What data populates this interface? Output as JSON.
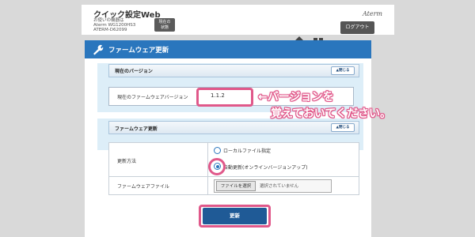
{
  "header": {
    "app_title": "クイック設定Web",
    "device_lines": [
      "お使いの機器は",
      "Aterm WG1200HS3",
      "ATERM-D62099"
    ],
    "status_button_lines": [
      "現在の",
      "状態"
    ],
    "brand": "Aterm",
    "logout_label": "ログアウト"
  },
  "page": {
    "title": "ファームウェア更新"
  },
  "version_section": {
    "title": "現在のバージョン",
    "close_label": "▲閉じる",
    "field_label": "現在のファームウェアバージョン",
    "field_value": "1.1.2"
  },
  "update_section": {
    "title": "ファームウェア更新",
    "close_label": "▲閉じる",
    "method_label": "更新方法",
    "options": [
      {
        "label": "ローカルファイル指定",
        "selected": false
      },
      {
        "label": "自動更新(オンラインバージョンアップ)",
        "selected": true
      }
    ],
    "file_label": "ファームウェアファイル",
    "file_select_label": "ファイルを選択",
    "file_status": "選択されていません",
    "update_button_label": "更新"
  },
  "annotation": {
    "line1": "←バージョンを",
    "line2": "覚えておいてください。",
    "color": "#e0588a"
  },
  "colors": {
    "header_blue": "#2a76bd",
    "section_bg": "#ddeef8",
    "button_dark": "#555555",
    "update_button": "#1f5a96"
  },
  "icons": [
    "home-icon",
    "qr-icon",
    "wrench-icon"
  ]
}
